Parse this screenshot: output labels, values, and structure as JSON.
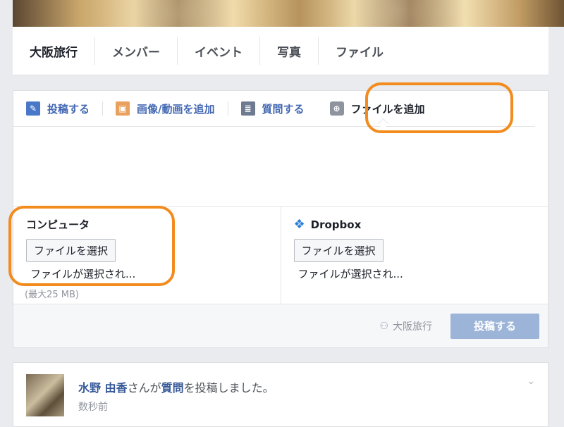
{
  "nav": {
    "tabs": [
      "大阪旅行",
      "メンバー",
      "イベント",
      "写真",
      "ファイル"
    ]
  },
  "composer": {
    "tabs": [
      {
        "label": "投稿する",
        "icon": "pencil-icon"
      },
      {
        "label": "画像/動画を追加",
        "icon": "photo-icon"
      },
      {
        "label": "質問する",
        "icon": "question-list-icon"
      },
      {
        "label": "ファイルを追加",
        "icon": "add-file-icon"
      }
    ],
    "computer": {
      "title": "コンピュータ",
      "button": "ファイルを選択",
      "status": "ファイルが選択され...",
      "hint": "(最大25 MB)"
    },
    "dropbox": {
      "title": "Dropbox",
      "button": "ファイルを選択",
      "status": "ファイルが選択され..."
    },
    "footer": {
      "audience": "大阪旅行",
      "post_button": "投稿する"
    }
  },
  "feed": {
    "author": "水野 由香",
    "text_mid": "さんが",
    "link2": "質問",
    "text_end": "を投稿しました。",
    "time": "数秒前"
  },
  "colors": {
    "highlight": "#f28c1f",
    "link": "#365899"
  }
}
